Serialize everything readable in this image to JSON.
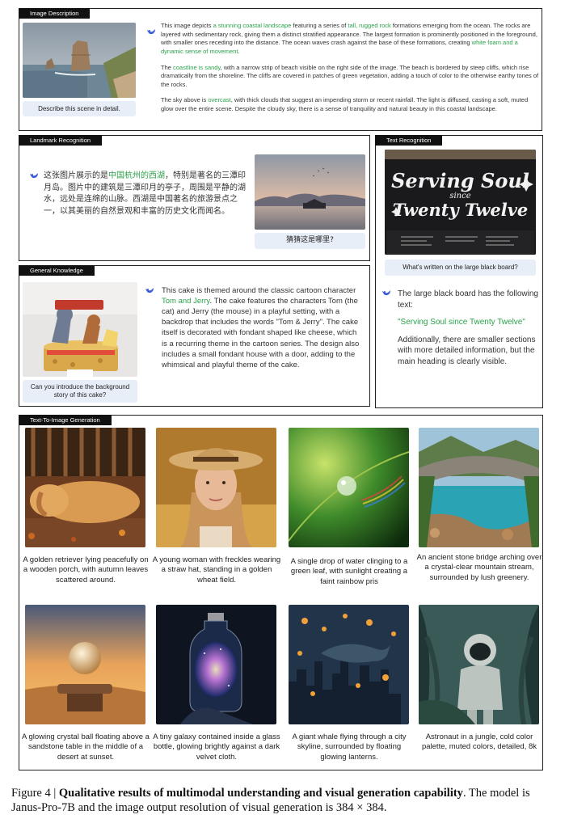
{
  "image_description": {
    "tag": "Image Description",
    "question": "Describe this scene in detail.",
    "p1": [
      "This image depicts ",
      "a stunning coastal landscape",
      " featuring a series of ",
      "tall, rugged rock",
      " formations emerging from the ocean. The rocks are layered with sedimentary rock, giving them a distinct stratified appearance. The largest formation is prominently positioned in the foreground, with smaller ones receding into the distance. The ocean waves crash against the base of these formations, creating ",
      "white foam and a dynamic sense of movement",
      "."
    ],
    "p2": [
      "The ",
      "coastline is sandy",
      ", with a narrow strip of beach visible on the right side of the image. The beach is bordered by steep cliffs, which rise dramatically from the shoreline. The cliffs are covered in patches of green vegetation, adding a touch of color to the otherwise earthy tones of the rocks."
    ],
    "p3": [
      "The sky above is ",
      "overcast",
      ", with thick clouds that suggest an impending storm or recent rainfall. The light is diffused, casting a soft, muted glow over the entire scene. Despite the cloudy sky, there is a sense of tranquility and natural beauty in this coastal landscape."
    ]
  },
  "landmark": {
    "tag": "Landmark Recognition",
    "question": "猜猜这是哪里?",
    "answer": [
      "这张图片展示的是",
      "中国杭州的西湖",
      "，特别是著名的三潭印月岛。图片中的建筑是三潭印月的亭子，周围是平静的湖水，远处是连绵的山脉。西湖是中国著名的旅游景点之一，以其美丽的自然景观和丰富的历史文化而闻名。"
    ]
  },
  "text_recognition": {
    "tag": "Text Recognition",
    "sign_line1": "Serving Soul",
    "sign_line2": "since",
    "sign_line3": "Twenty Twelve",
    "question": "What's written on the large black board?",
    "a1": "The large black board has the following text:",
    "a2": "\"Serving Soul since Twenty Twelve\"",
    "a3": "Additionally, there are smaller sections with more detailed information, but the main heading is clearly visible."
  },
  "general_knowledge": {
    "tag": "General Knowledge",
    "question": "Can you introduce the background story of this cake?",
    "answer": [
      "This cake is themed around the classic cartoon character ",
      "Tom and Jerry",
      ". The cake features the characters Tom (the cat) and Jerry (the mouse) in a playful setting, with a backdrop that includes the words \"Tom & Jerry\". The cake itself is decorated with fondant shaped like cheese, which is a recurring theme in the cartoon series. The design also includes a small fondant house with a door, adding to the whimsical and playful theme of the cake."
    ]
  },
  "t2i": {
    "tag": "Text-To-Image Generation",
    "captions": [
      "A golden retriever lying peacefully on a wooden porch, with autumn leaves scattered around.",
      "A young woman with freckles wearing a straw hat, standing in a golden wheat field.",
      "A single drop of water clinging to a green leaf, with sunlight creating a faint rainbow pris",
      "An ancient stone bridge arching over a crystal-clear mountain stream, surrounded by lush greenery.",
      "A glowing crystal ball floating above a sandstone table in the middle of a desert at sunset.",
      "A tiny galaxy contained inside a glass bottle, glowing brightly against a dark velvet cloth.",
      "A giant whale flying through a city skyline, surrounded by floating glowing lanterns.",
      "Astronaut in a jungle, cold color palette, muted colors, detailed, 8k"
    ]
  },
  "figure_caption": {
    "label": "Figure 4 | ",
    "bold": "Qualitative results of multimodal understanding and visual generation capability",
    "rest": ". The model is Janus-Pro-7B and the image output resolution of visual generation is 384 × 384."
  }
}
